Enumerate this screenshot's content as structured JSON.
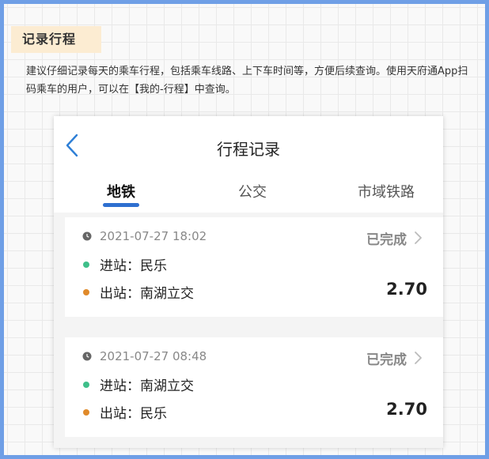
{
  "section": {
    "title": "记录行程"
  },
  "description": "建议仔细记录每天的乘车行程，包括乘车线路、上下车时间等，方便后续查询。使用天府通App扫码乘车的用户，可以在【我的-行程】中查询。",
  "app": {
    "title": "行程记录",
    "tabs": [
      {
        "label": "地铁",
        "active": true
      },
      {
        "label": "公交",
        "active": false
      },
      {
        "label": "市域铁路",
        "active": false
      }
    ],
    "trips": [
      {
        "time": "2021-07-27 18:02",
        "status": "已完成",
        "entry": "进站：民乐",
        "exit": "出站：南湖立交",
        "fare": "2.70"
      },
      {
        "time": "2021-07-27 08:48",
        "status": "已完成",
        "entry": "进站：南湖立交",
        "exit": "出站：民乐",
        "fare": "2.70"
      }
    ]
  },
  "colors": {
    "frame_border": "#6f9fe6",
    "tag_background": "#fcecd2",
    "tab_indicator": "#2e6fd0",
    "entry_dot": "#3fbf8a",
    "exit_dot": "#e08a2a",
    "back_arrow": "#2e7fd6"
  },
  "icons": {
    "back": "chevron-left-icon",
    "clock": "clock-icon",
    "detail": "chevron-right-icon"
  }
}
